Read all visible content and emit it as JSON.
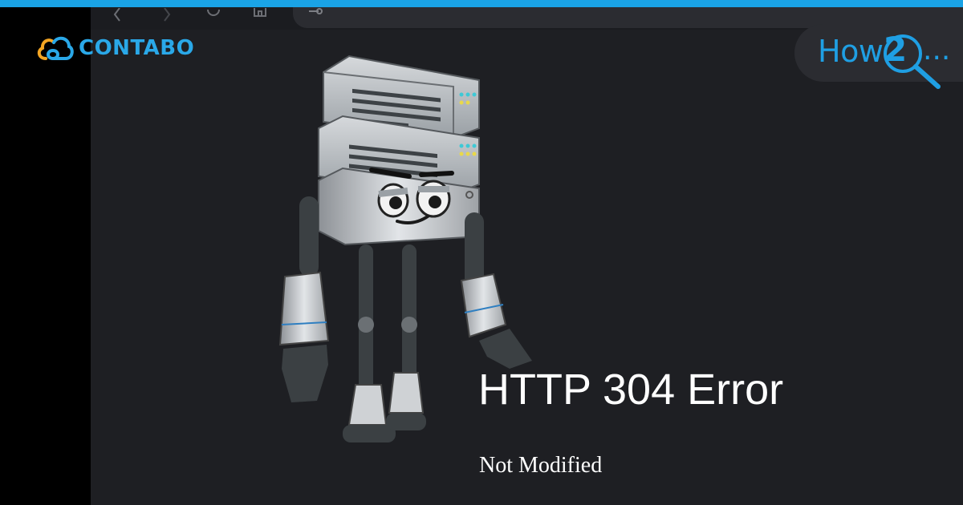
{
  "brand": {
    "logo_text": "CONTABO",
    "logo_icon": "cloud-logo-icon",
    "accent_color": "#1aa3e6",
    "logo_orange": "#f5a623"
  },
  "badge": {
    "text": "How",
    "number": "2",
    "dots": "...",
    "icon": "magnifier-icon"
  },
  "browser": {
    "toolbar_icons": [
      "back-icon",
      "forward-icon",
      "reload-icon",
      "home-icon"
    ],
    "address_icon": "site-settings-icon"
  },
  "main": {
    "title": "HTTP 304 Error",
    "subtitle": "Not Modified"
  }
}
